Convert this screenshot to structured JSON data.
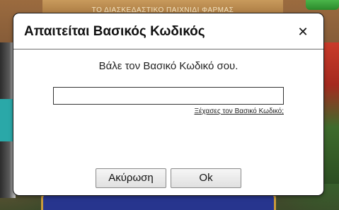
{
  "background": {
    "banner_text": "ΤΟ ΔΙΑΣΚΕΔΑΣΤΙΚΟ ΠΑΙΧΝΙΔΙ ΦΑΡΜΑΣ"
  },
  "dialog": {
    "title": "Απαιτείται Βασικός Κωδικός",
    "close_symbol": "✕",
    "prompt": "Βάλε τον Βασικό Κωδικό σου.",
    "input_value": "",
    "input_placeholder": "",
    "forgot_link": "Ξέχασες τον Βασικό Κωδικό;",
    "cancel_label": "Ακύρωση",
    "ok_label": "Ok"
  },
  "colors": {
    "dialog_bg": "#ffffff",
    "border": "#6e6e6e",
    "accent_green": "#2b8a2b",
    "panel_blue": "#27358e",
    "panel_gold": "#c99a3c"
  }
}
